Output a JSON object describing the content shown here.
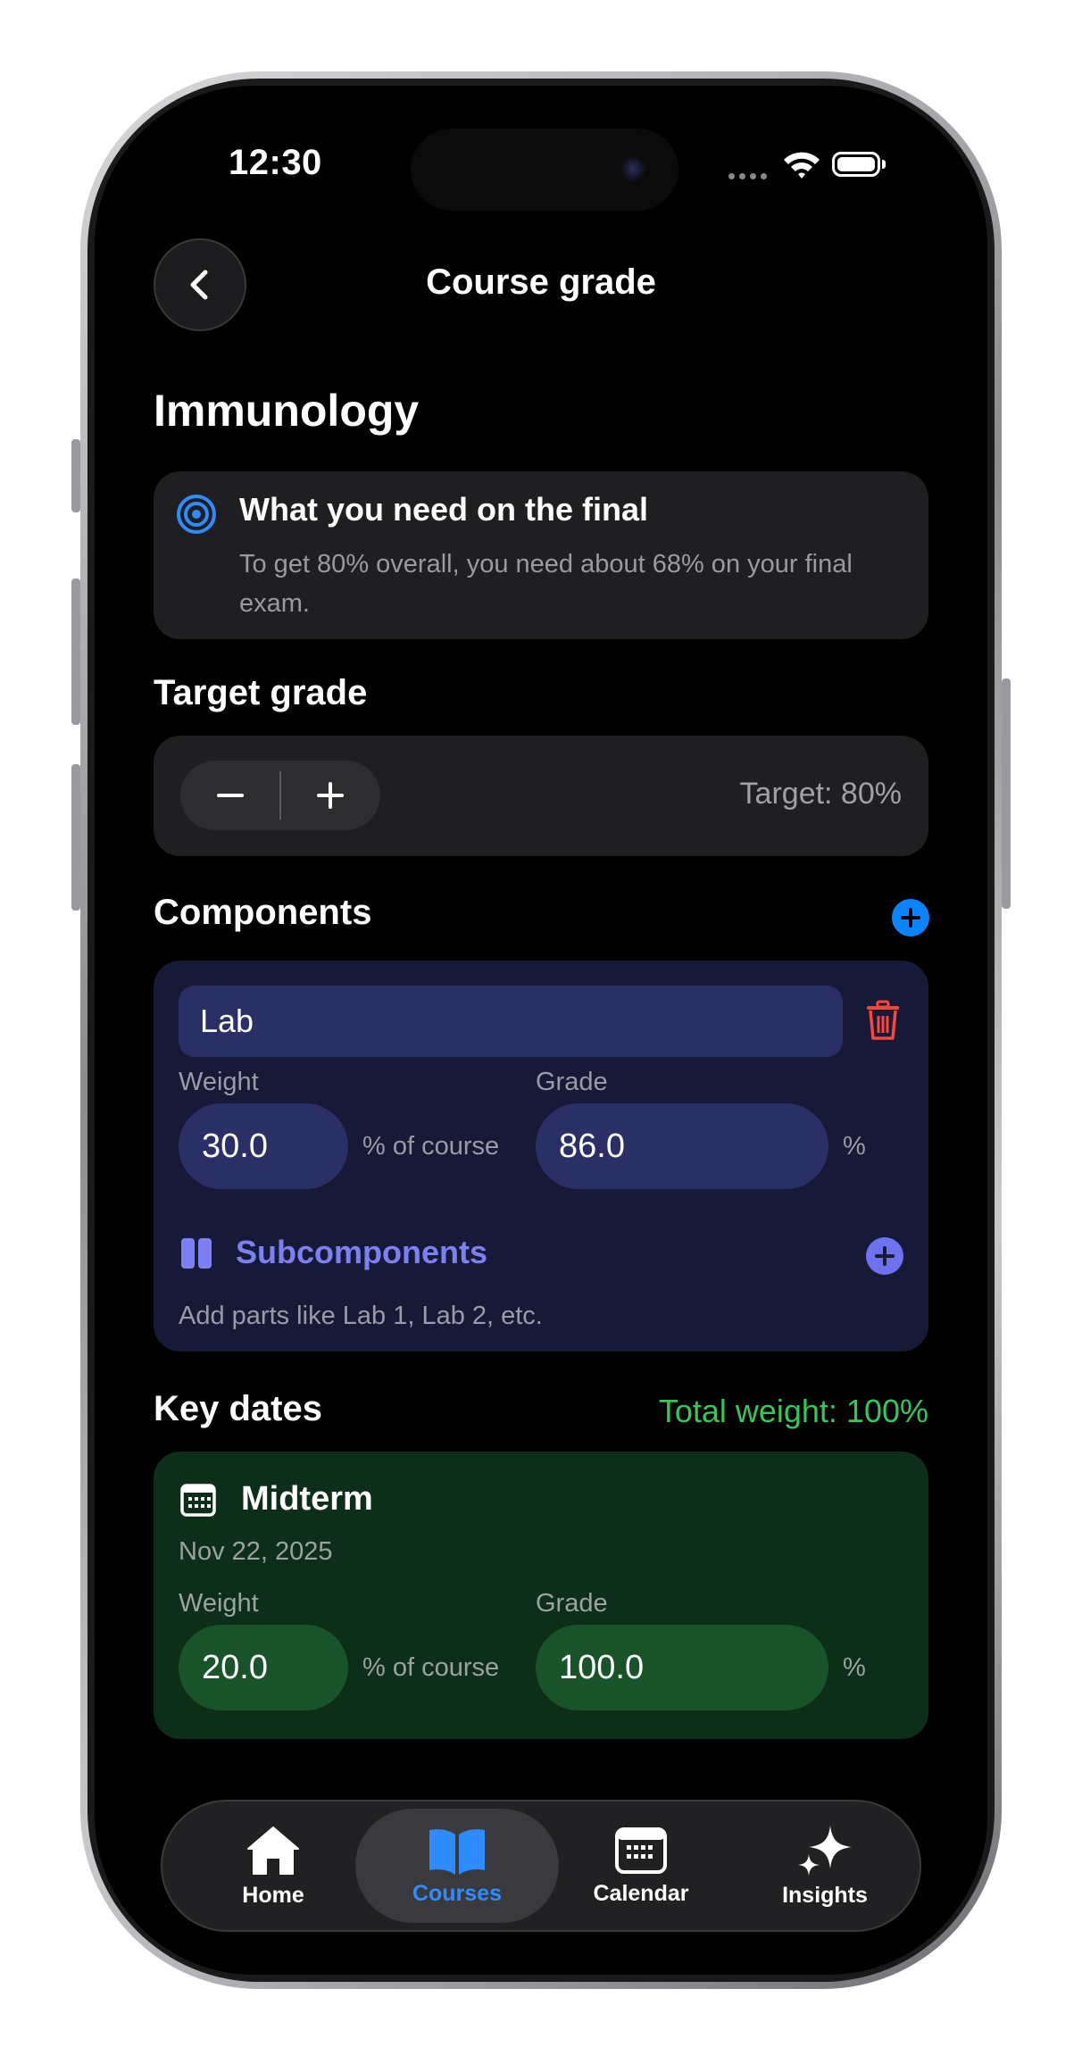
{
  "status_bar": {
    "time": "12:30"
  },
  "header": {
    "title": "Course grade"
  },
  "course": {
    "name": "Immunology"
  },
  "final_hint": {
    "title": "What you need on the final",
    "body": "To get 80% overall, you need about 68% on your final exam."
  },
  "target_grade": {
    "heading": "Target grade",
    "minus_symbol": "−",
    "plus_symbol": "+",
    "label": "Target: 80%"
  },
  "components": {
    "heading": "Components",
    "items": [
      {
        "name": "Lab",
        "weight_label": "Weight",
        "weight_value": "30.0",
        "weight_unit": "% of course",
        "grade_label": "Grade",
        "grade_value": "86.0",
        "grade_unit": "%",
        "subcomponents_label": "Subcomponents",
        "subcomponents_hint": "Add parts like Lab 1, Lab 2, etc."
      }
    ]
  },
  "key_dates": {
    "heading": "Key dates",
    "total_weight": "Total weight: 100%",
    "items": [
      {
        "title": "Midterm",
        "date": "Nov 22, 2025",
        "weight_label": "Weight",
        "weight_value": "20.0",
        "weight_unit": "% of course",
        "grade_label": "Grade",
        "grade_value": "100.0",
        "grade_unit": "%"
      }
    ]
  },
  "tab_bar": {
    "tabs": [
      {
        "label": "Home",
        "icon": "house-icon"
      },
      {
        "label": "Courses",
        "icon": "book-icon",
        "active": true
      },
      {
        "label": "Calendar",
        "icon": "calendar-icon"
      },
      {
        "label": "Insights",
        "icon": "sparkles-icon"
      }
    ]
  },
  "colors": {
    "accent_blue": "#2f8cff",
    "component_card": "#171a37",
    "component_field": "#2a2f66",
    "subcomponent_purple": "#7d80f2",
    "date_card": "#0d2e18",
    "date_field": "#19532a",
    "total_weight_green": "#34c759",
    "delete_red": "#ff453a"
  }
}
